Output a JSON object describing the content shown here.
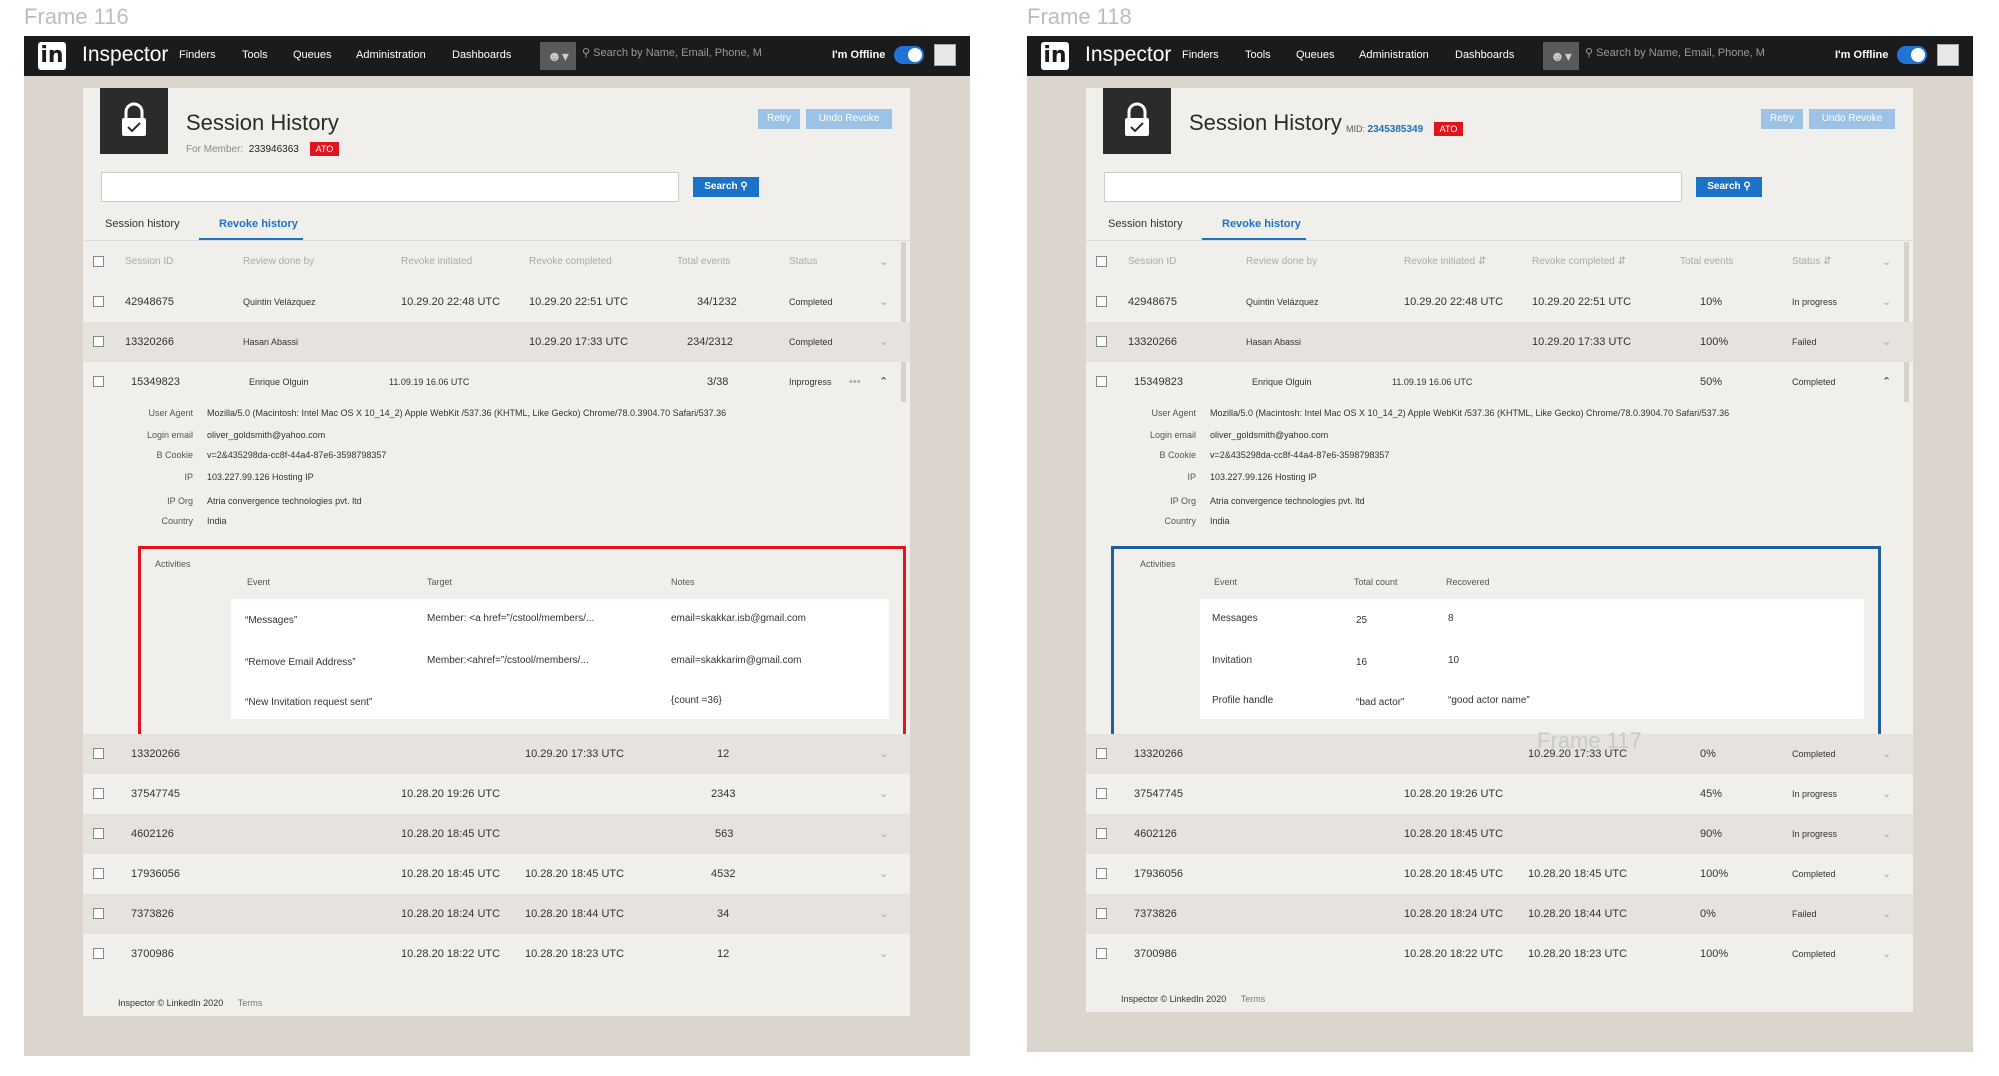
{
  "frames": [
    {
      "label": "Frame 116",
      "navbar": {
        "logo": "in",
        "app_name": "Inspector",
        "items": [
          "Finders",
          "Tools",
          "Queues",
          "Administration",
          "Dashboards"
        ],
        "search_placeholder": "Search by Name, Email, Phone, M",
        "status_label": "I'm Offline"
      },
      "header": {
        "title": "Session History",
        "member_label": "For Member:",
        "member_id": "233946363",
        "badge": "ATO",
        "retry": "Retry",
        "undo": "Undo Revoke",
        "search_button": "Search"
      },
      "tabs": [
        "Session history",
        "Revoke history"
      ],
      "columns": [
        "Session ID",
        "Review done by",
        "Revoke initiated",
        "Revoke completed",
        "Total events",
        "Status"
      ],
      "rows_top": [
        {
          "id": "42948675",
          "reviewer": "Quintin Velázquez",
          "initiated": "10.29.20 22:48 UTC",
          "completed": "10.29.20 22:51 UTC",
          "events": "34/1232",
          "status": "Completed"
        },
        {
          "id": "13320266",
          "reviewer": "Hasan Abassi",
          "initiated": "",
          "completed": "10.29.20 17:33 UTC",
          "events": "234/2312",
          "status": "Completed"
        },
        {
          "id": "15349823",
          "reviewer": "Enrique Olguin",
          "initiated": "11.09.19 16.06 UTC",
          "completed": "",
          "events": "3/38",
          "status": "Inprogress"
        }
      ],
      "details": {
        "labels": [
          "User Agent",
          "Login email",
          "B Cookie",
          "IP",
          "IP Org",
          "Country"
        ],
        "values": [
          "Mozilla/5.0 (Macintosh: Intel Mac OS X  10_14_2) Apple WebKit /537.36 (KHTML, Like Gecko) Chrome/78.0.3904.70 Safari/537.36",
          "oliver_goldsmith@yahoo.com",
          "v=2&435298da-cc8f-44a4-87e6-3598798357",
          "103.227.99.126   Hosting IP",
          "Atria convergence technologies pvt. ltd",
          "India"
        ]
      },
      "activities": {
        "title": "Activities",
        "headers": [
          "Event",
          "Target",
          "Notes"
        ],
        "rows": [
          [
            "“Messages”",
            "Member: <a href=”/cstool/members/...",
            "email=skakkar.isb@gmail.com"
          ],
          [
            "“Remove Email Address”",
            "Member:<ahref=”/cstool/members/...",
            "email=skakkarim@gmail.com"
          ],
          [
            "“New Invitation request sent”",
            "",
            "{count =36}"
          ]
        ]
      },
      "rows_bottom": [
        {
          "id": "13320266",
          "initiated": "",
          "completed": "10.29.20 17:33 UTC",
          "events": "12"
        },
        {
          "id": "37547745",
          "initiated": "10.28.20 19:26 UTC",
          "completed": "",
          "events": "2343"
        },
        {
          "id": "4602126",
          "initiated": "10.28.20 18:45 UTC",
          "completed": "",
          "events": "563"
        },
        {
          "id": "17936056",
          "initiated": "10.28.20 18:45 UTC",
          "completed": "10.28.20 18:45 UTC",
          "events": "4532"
        },
        {
          "id": "7373826",
          "initiated": "10.28.20 18:24 UTC",
          "completed": "10.28.20 18:44 UTC",
          "events": "34"
        },
        {
          "id": "3700986",
          "initiated": "10.28.20 18:22 UTC",
          "completed": "10.28.20 18:23 UTC",
          "events": "12"
        }
      ],
      "footer": {
        "copyright": "Inspector © LinkedIn 2020",
        "terms": "Terms"
      }
    },
    {
      "label": "Frame 118",
      "overlay_label": "Frame 117",
      "navbar": {
        "logo": "in",
        "app_name": "Inspector",
        "items": [
          "Finders",
          "Tools",
          "Queues",
          "Administration",
          "Dashboards"
        ],
        "search_placeholder": "Search by Name, Email, Phone, M",
        "status_label": "I'm Offline"
      },
      "header": {
        "title": "Session History",
        "mid_label": "MID:",
        "mid_value": "2345385349",
        "badge": "ATO",
        "retry": "Retry",
        "undo": "Undo Revoke",
        "search_button": "Search"
      },
      "tabs": [
        "Session history",
        "Revoke history"
      ],
      "columns": [
        "Session ID",
        "Review done by",
        "Revoke initiated",
        "Revoke completed",
        "Total events",
        "Status"
      ],
      "rows_top": [
        {
          "id": "42948675",
          "reviewer": "Quintin Velázquez",
          "initiated": "10.29.20 22:48 UTC",
          "completed": "10.29.20 22:51 UTC",
          "events": "10%",
          "status": "In progress"
        },
        {
          "id": "13320266",
          "reviewer": "Hasan Abassi",
          "initiated": "",
          "completed": "10.29.20 17:33 UTC",
          "events": "100%",
          "status": "Failed"
        },
        {
          "id": "15349823",
          "reviewer": "Enrique Olguin",
          "initiated": "11.09.19 16.06 UTC",
          "completed": "",
          "events": "50%",
          "status": "Completed"
        }
      ],
      "details": {
        "labels": [
          "User Agent",
          "Login email",
          "B Cookie",
          "IP",
          "IP Org",
          "Country"
        ],
        "values": [
          "Mozilla/5.0 (Macintosh: Intel Mac OS X  10_14_2) Apple WebKit /537.36 (KHTML, Like Gecko) Chrome/78.0.3904.70 Safari/537.36",
          "oliver_goldsmith@yahoo.com",
          "v=2&435298da-cc8f-44a4-87e6-3598798357",
          "103.227.99.126   Hosting IP",
          "Atria convergence technologies pvt. ltd",
          "India"
        ]
      },
      "activities": {
        "title": "Activities",
        "headers": [
          "Event",
          "Total count",
          "Recovered"
        ],
        "rows": [
          [
            "Messages",
            "25",
            "8"
          ],
          [
            "Invitation",
            "16",
            "10"
          ],
          [
            "Profile handle",
            "“bad actor”",
            "“good actor name”"
          ]
        ]
      },
      "rows_bottom": [
        {
          "id": "13320266",
          "initiated": "",
          "completed": "10.29.20 17:33 UTC",
          "events": "0%",
          "status": "Completed"
        },
        {
          "id": "37547745",
          "initiated": "10.28.20 19:26 UTC",
          "completed": "",
          "events": "45%",
          "status": "In progress"
        },
        {
          "id": "4602126",
          "initiated": "10.28.20 18:45 UTC",
          "completed": "",
          "events": "90%",
          "status": "In progress"
        },
        {
          "id": "17936056",
          "initiated": "10.28.20 18:45 UTC",
          "completed": "10.28.20 18:45 UTC",
          "events": "100%",
          "status": "Completed"
        },
        {
          "id": "7373826",
          "initiated": "10.28.20 18:24 UTC",
          "completed": "10.28.20 18:44 UTC",
          "events": "0%",
          "status": "Failed"
        },
        {
          "id": "3700986",
          "initiated": "10.28.20 18:22 UTC",
          "completed": "10.28.20 18:23 UTC",
          "events": "100%",
          "status": "Completed"
        }
      ],
      "footer": {
        "copyright": "Inspector © LinkedIn 2020",
        "terms": "Terms"
      }
    }
  ],
  "colors": {
    "accent": "#1a73c9",
    "ato": "#e1141e",
    "highlight_red": "#e1141e",
    "highlight_blue": "#1f5f9e",
    "frame_bg": "#dcd5cd",
    "panel_bg": "#f1efeb"
  },
  "icons": [
    "linkedin-logo",
    "person-icon",
    "search-icon",
    "lock-icon",
    "checkbox-icon",
    "chevron-down-icon",
    "chevron-up-icon",
    "more-icon"
  ]
}
